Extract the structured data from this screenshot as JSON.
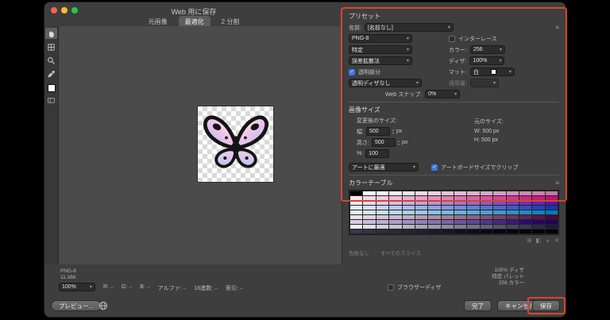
{
  "window": {
    "title": "Web 用に保存",
    "tabs": [
      {
        "label": "元画像"
      },
      {
        "label": "最適化"
      },
      {
        "label": "2 分割"
      }
    ]
  },
  "preset": {
    "header": "プリセット",
    "name_label": "名前:",
    "name_value": "[名前なし]",
    "format_value": "PNG-8",
    "interlace_label": "インターレース",
    "reduction_value": "特定",
    "colors_label": "カラー:",
    "colors_value": "256",
    "dither_method_value": "誤差拡散法",
    "dither_label": "ディザ:",
    "dither_value": "100%",
    "transparency_label": "透明部分",
    "matte_label": "マット:",
    "matte_value": "白",
    "trans_dither_value": "透明ディザなし",
    "amount_label": "適用量:",
    "websnap_label": "Web スナップ:",
    "websnap_value": "0%"
  },
  "image_size": {
    "header": "画像サイズ",
    "new_label": "変更後のサイズ:",
    "orig_label": "元のサイズ:",
    "width_label": "幅:",
    "width_value": "500",
    "width_unit": "px",
    "height_label": "高さ:",
    "height_value": "500",
    "height_unit": "px",
    "percent_label": "%:",
    "percent_value": "100",
    "orig_w": "W: 500 px",
    "orig_h": "H: 500 px",
    "fit_value": "アートに最適",
    "clip_label": "アートボードサイズでクリップ"
  },
  "color_table": {
    "header": "カラーテーブル",
    "footer_left": "色数なし",
    "footer_right": "すべてのスライス",
    "palette": [
      "#000000",
      "#ffffff",
      "#fdf6fa",
      "#f9ecf4",
      "#f5e2ee",
      "#f1d8e8",
      "#edcee2",
      "#e9c4dc",
      "#e5bad6",
      "#e1b0d0",
      "#dda6ca",
      "#d99cc4",
      "#d592be",
      "#d188b8",
      "#cd7eb2",
      "#c974ac",
      "#fbe4ef",
      "#f7d6e6",
      "#f3c8dd",
      "#efbad4",
      "#ebaccb",
      "#e79ec2",
      "#e390b9",
      "#df82b0",
      "#db74a7",
      "#d7669e",
      "#d35895",
      "#cf4a8c",
      "#cb3c83",
      "#c72e7a",
      "#c32071",
      "#bf1268",
      "#f0e8fa",
      "#e6daf5",
      "#dcccf0",
      "#d2beeb",
      "#c8b0e6",
      "#bea2e1",
      "#b494dc",
      "#aa86d7",
      "#a078d2",
      "#966acd",
      "#8c5cc8",
      "#824ec3",
      "#7840be",
      "#6e32b9",
      "#6424b4",
      "#5a16af",
      "#e6ecfa",
      "#d8e0f5",
      "#cad4f0",
      "#bcc8eb",
      "#aebce6",
      "#a0b0e1",
      "#92a4dc",
      "#8498d7",
      "#768cd2",
      "#6880cd",
      "#5a74c8",
      "#4c68c3",
      "#3e5cbe",
      "#3050b9",
      "#2244b4",
      "#1438af",
      "#e4f1fb",
      "#d5e9f7",
      "#c6e1f3",
      "#b7d9ef",
      "#a8d1eb",
      "#99c9e7",
      "#8ac1e3",
      "#7bb9df",
      "#6cb1db",
      "#5da9d7",
      "#4ea1d3",
      "#3f99cf",
      "#3091cb",
      "#2189c7",
      "#1281c3",
      "#0379bf",
      "#efe3ea",
      "#e4d4de",
      "#d9c5d2",
      "#cebbc9",
      "#c3acbd",
      "#b89db1",
      "#ad8ea5",
      "#a27f99",
      "#97708d",
      "#8c6181",
      "#815275",
      "#764369",
      "#6b345d",
      "#602551",
      "#551645",
      "#4a0739",
      "#d5cde4",
      "#c8bedb",
      "#bbafd2",
      "#aea0c9",
      "#a191c0",
      "#9482b7",
      "#8773ae",
      "#7a64a5",
      "#6d559c",
      "#604693",
      "#533789",
      "#46287f",
      "#391975",
      "#2c0a6b",
      "#250661",
      "#1e0357",
      "#eceef2",
      "#dee0e6",
      "#d0d2da",
      "#c2c4ce",
      "#b4b6c2",
      "#a6a8b6",
      "#989aaa",
      "#8a8c9e",
      "#7c7e92",
      "#6e7086",
      "#60627a",
      "#52546e",
      "#444662",
      "#363856",
      "#282a4a",
      "#1a1c3e",
      "#3c364a",
      "#373145",
      "#322c40",
      "#2d273b",
      "#282236",
      "#231d31",
      "#1e182c",
      "#191327",
      "#140e22",
      "#100a1d",
      "#0c0718",
      "#090513",
      "#060310",
      "#04020c",
      "#020108",
      "#010004"
    ]
  },
  "status": {
    "format": "PNG-8",
    "size": "11.36K",
    "info_lines": [
      "100% ディザ",
      "特定 パレット",
      "256 カラー"
    ]
  },
  "controls": {
    "zoom_value": "100%",
    "stats": [
      {
        "label": "R:",
        "value": "–"
      },
      {
        "label": "G:",
        "value": "–"
      },
      {
        "label": "B:",
        "value": "–"
      },
      {
        "label": "アルファ:",
        "value": "–"
      },
      {
        "label": "16進数:",
        "value": "–"
      },
      {
        "label": "索引:",
        "value": "–"
      }
    ],
    "browser_dither_label": "ブラウザーディザ"
  },
  "buttons": {
    "preview": "プレビュー...",
    "done": "完了",
    "cancel": "キャンセル",
    "save": "保存"
  },
  "icons": {
    "menu": "≡",
    "chevron": "▾",
    "check": "✓",
    "up": "▴",
    "down": "▾"
  },
  "annotation_color": "#d6452f"
}
